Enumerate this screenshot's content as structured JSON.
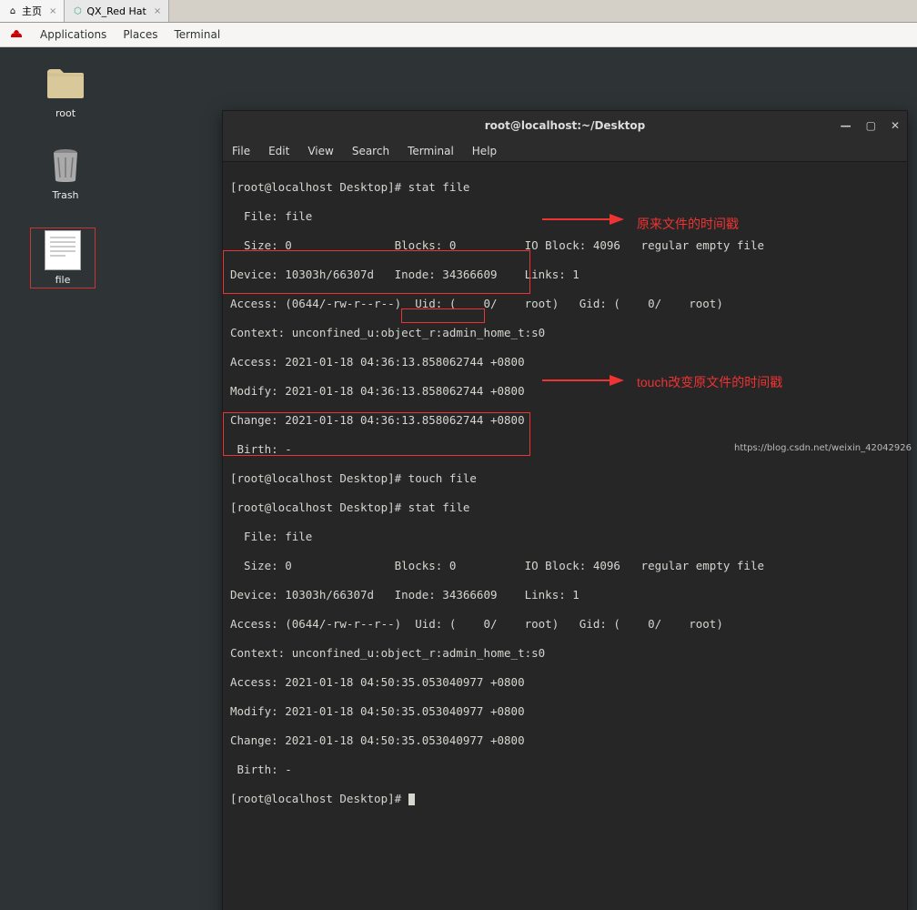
{
  "browser": {
    "tabs": [
      {
        "label": "主页",
        "icon": "⌂"
      },
      {
        "label": "QX_Red Hat",
        "icon": "⬡"
      }
    ]
  },
  "gnome": {
    "apps": "Applications",
    "places": "Places",
    "terminal": "Terminal"
  },
  "desktop_icons": {
    "root": "root",
    "trash": "Trash",
    "file": "file"
  },
  "terminal": {
    "title": "root@localhost:~/Desktop",
    "menu": [
      "File",
      "Edit",
      "View",
      "Search",
      "Terminal",
      "Help"
    ],
    "lines": [
      "[root@localhost Desktop]# stat file",
      "  File: file",
      "  Size: 0               Blocks: 0          IO Block: 4096   regular empty file",
      "Device: 10303h/66307d   Inode: 34366609    Links: 1",
      "Access: (0644/-rw-r--r--)  Uid: (    0/    root)   Gid: (    0/    root)",
      "Context: unconfined_u:object_r:admin_home_t:s0",
      "Access: 2021-01-18 04:36:13.858062744 +0800",
      "Modify: 2021-01-18 04:36:13.858062744 +0800",
      "Change: 2021-01-18 04:36:13.858062744 +0800",
      " Birth: -",
      "[root@localhost Desktop]# touch file",
      "[root@localhost Desktop]# stat file",
      "  File: file",
      "  Size: 0               Blocks: 0          IO Block: 4096   regular empty file",
      "Device: 10303h/66307d   Inode: 34366609    Links: 1",
      "Access: (0644/-rw-r--r--)  Uid: (    0/    root)   Gid: (    0/    root)",
      "Context: unconfined_u:object_r:admin_home_t:s0",
      "Access: 2021-01-18 04:50:35.053040977 +0800",
      "Modify: 2021-01-18 04:50:35.053040977 +0800",
      "Change: 2021-01-18 04:50:35.053040977 +0800",
      " Birth: -",
      "[root@localhost Desktop]# "
    ]
  },
  "annotations": {
    "label1": "原来文件的时间戳",
    "label2": "touch改变原文件的时间戳"
  },
  "watermark": "https://blog.csdn.net/weixin_42042926"
}
